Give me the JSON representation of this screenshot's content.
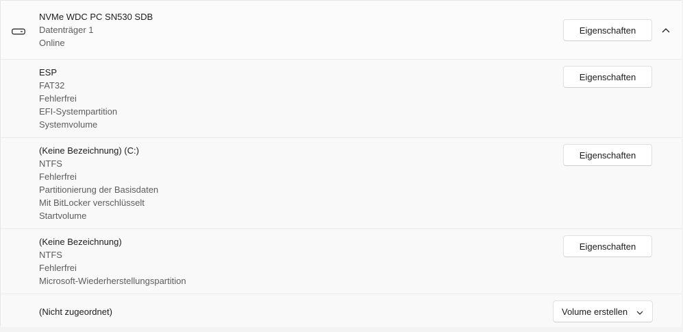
{
  "disk": {
    "name": "NVMe WDC PC SN530 SDB",
    "disk_label": "Datenträger 1",
    "status": "Online",
    "properties_label": "Eigenschaften",
    "icon": "drive-icon",
    "expand_icon": "chevron-up-icon"
  },
  "partitions": [
    {
      "lines": [
        "ESP",
        "FAT32",
        "Fehlerfrei",
        "EFI-Systempartition",
        "Systemvolume"
      ],
      "properties_label": "Eigenschaften"
    },
    {
      "lines": [
        "(Keine Bezeichnung) (C:)",
        "NTFS",
        "Fehlerfrei",
        "Partitionierung der Basisdaten",
        "Mit BitLocker verschlüsselt",
        "Startvolume"
      ],
      "properties_label": "Eigenschaften"
    },
    {
      "lines": [
        "(Keine Bezeichnung)",
        "NTFS",
        "Fehlerfrei",
        "Microsoft-Wiederherstellungspartition"
      ],
      "properties_label": "Eigenschaften"
    }
  ],
  "unallocated": {
    "label": "(Nicht zugeordnet)",
    "create_volume_label": "Volume erstellen",
    "dropdown_icon": "chevron-down-icon"
  }
}
